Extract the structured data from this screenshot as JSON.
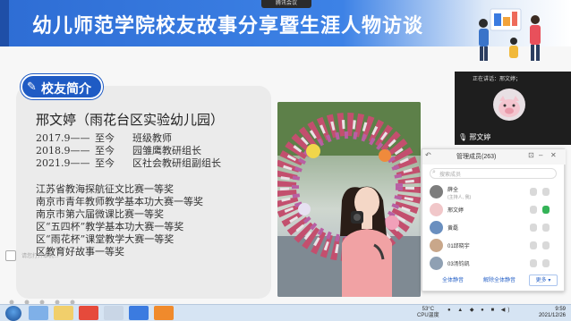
{
  "slide": {
    "title": "幼儿师范学院校友故事分享暨生涯人物访谈",
    "intro_tag": "校友简介",
    "name_line": "邢文婷（雨花台区实验幼儿园）",
    "roles": [
      {
        "period": "2017.9——",
        "to": "至今",
        "title": "班级教师"
      },
      {
        "period": "2018.9——",
        "to": "至今",
        "title": "园雏鹰教研组长"
      },
      {
        "period": "2021.9——",
        "to": "至今",
        "title": "区社会教研组副组长"
      }
    ],
    "awards": [
      "江苏省教海探航征文比赛一等奖",
      "南京市青年教师教学基本功大赛一等奖",
      "南京市第六届微课比赛一等奖",
      "区“五四杯”教学基本功大赛一等奖",
      "区“雨花杯”课堂教学大赛一等奖",
      "区教育好故事一等奖"
    ],
    "left_hint": "请您打开本机..."
  },
  "meeting": {
    "tab_label": "腾讯会议",
    "speaker_label": "正在讲话：邢文婷；",
    "speaker_name": "邢文婷"
  },
  "members": {
    "title": "管理成员(263)",
    "search_placeholder": "搜索成员",
    "rows": [
      {
        "name": "薛全",
        "sub": "(主持人, 我)",
        "avatar_color": "#7d7d7d"
      },
      {
        "name": "邢文婷",
        "sub": "",
        "avatar_color": "#f1c7c9"
      },
      {
        "name": "黄磊",
        "sub": "",
        "avatar_color": "#6a8fbf"
      },
      {
        "name": "01邱晓宇",
        "sub": "",
        "avatar_color": "#c9a78a"
      },
      {
        "name": "03汤钧凯",
        "sub": "",
        "avatar_color": "#8fa0b3"
      }
    ],
    "mute_all": "全体静音",
    "unmute_all": "解除全体静音",
    "more": "更多"
  },
  "taskbar": {
    "temperature": "53°C",
    "cpu_label": "CPU温度",
    "time": "9:59",
    "date": "2021/12/26"
  },
  "colors": {
    "title_blue": "#2e6dd4",
    "tag_blue": "#1f5bc4",
    "mic_green": "#34b357"
  }
}
